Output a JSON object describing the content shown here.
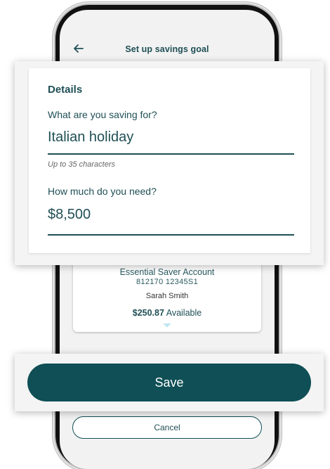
{
  "app": {
    "title": "Set up savings goal"
  },
  "details": {
    "heading": "Details",
    "goal_label": "What are you saving for?",
    "goal_value": "Italian holiday",
    "goal_hint": "Up to 35 characters",
    "amount_label": "How much do you need?",
    "amount_value": "$8,500"
  },
  "account": {
    "name": "Essential Saver Account",
    "number": "812170  12345S1",
    "holder": "Sarah Smith",
    "balance": "$250.87",
    "balance_suffix": " Available"
  },
  "buttons": {
    "save": "Save",
    "cancel": "Cancel"
  },
  "colors": {
    "primary": "#0f4f55",
    "text": "#1f4f55",
    "background": "#f2f2f2"
  }
}
